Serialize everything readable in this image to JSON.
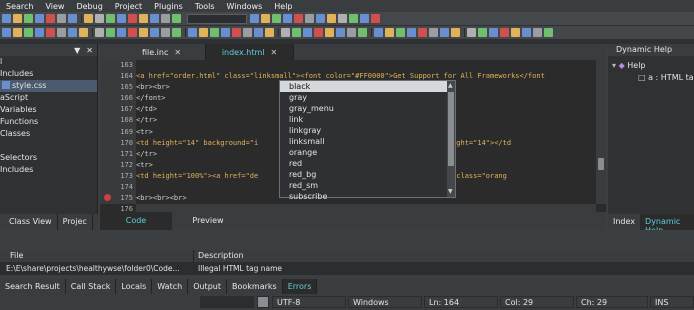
{
  "menu": [
    "Search",
    "View",
    "Debug",
    "Project",
    "Plugins",
    "Tools",
    "Windows",
    "Help"
  ],
  "left_panel": {
    "items": [
      {
        "label": "l",
        "selected": false
      },
      {
        "label": "Includes",
        "selected": false
      },
      {
        "label": "style.css",
        "selected": true
      },
      {
        "label": "aScript",
        "selected": false
      },
      {
        "label": "Variables",
        "selected": false
      },
      {
        "label": "Functions",
        "selected": false
      },
      {
        "label": "Classes",
        "selected": false
      },
      {
        "label": "",
        "selected": false
      },
      {
        "label": "Selectors",
        "selected": false
      },
      {
        "label": "Includes",
        "selected": false
      }
    ],
    "tabs": [
      "Class View",
      "Projec"
    ]
  },
  "editor": {
    "tabs": [
      {
        "label": "file.inc",
        "active": false
      },
      {
        "label": "index.html",
        "active": true
      }
    ],
    "line_numbers": [
      "163",
      "164",
      "165",
      "166",
      "167",
      "168",
      "169",
      "170",
      "171",
      "172",
      "173",
      "174",
      "175",
      "176",
      "177"
    ],
    "lines": [
      "",
      "<a href=\"order.html\" class=\"linksmall\"><font color=\"#FF0000\">Get Support for All Frameworks</font",
      "<br><br>",
      "</font>",
      "</td>",
      "</tr>",
      "<tr>",
      "<td height=\"14\" background=\"i                              if\" width=\"1\" height=\"14\"></td",
      "</tr>",
      "<tr>",
      "<td height=\"100%\"><a href=\"de                              re Info</a><font class=\"orang",
      "",
      "<br><br><br>",
      "",
      "<table width=100% class=\"gra                              adding=5 cellspacing=0>"
    ],
    "view_tabs": [
      "Code",
      "Preview"
    ]
  },
  "autocomplete": {
    "items": [
      "black",
      "gray",
      "gray_menu",
      "link",
      "linkgray",
      "linksmall",
      "orange",
      "red",
      "red_bg",
      "red_sm",
      "subscribe"
    ],
    "selected_index": 0
  },
  "right_panel": {
    "title": "Dynamic Help",
    "tree": [
      "Help",
      "a : HTML tag"
    ],
    "tabs": [
      "Index",
      "Dynamic Help"
    ]
  },
  "errors": {
    "columns": [
      "File",
      "Description"
    ],
    "rows": [
      {
        "file": "E:\\E\\share\\projects\\healthywse\\folder0\\Code...",
        "description": "Illegal HTML tag name"
      }
    ]
  },
  "bottom_tabs": [
    "Search Result",
    "Call Stack",
    "Locals",
    "Watch",
    "Output",
    "Bookmarks",
    "Errors"
  ],
  "status": {
    "encoding": "UTF-8",
    "line_ending": "Windows",
    "line": "Ln: 164",
    "col": "Col: 29",
    "ch": "Ch: 29",
    "mode": "INS"
  },
  "colors": {
    "accent": "#5ed0e0",
    "background": "#3c3f41",
    "editor_bg": "#2b2b2b",
    "string": "#cc7832",
    "tag": "#e0b35a"
  }
}
